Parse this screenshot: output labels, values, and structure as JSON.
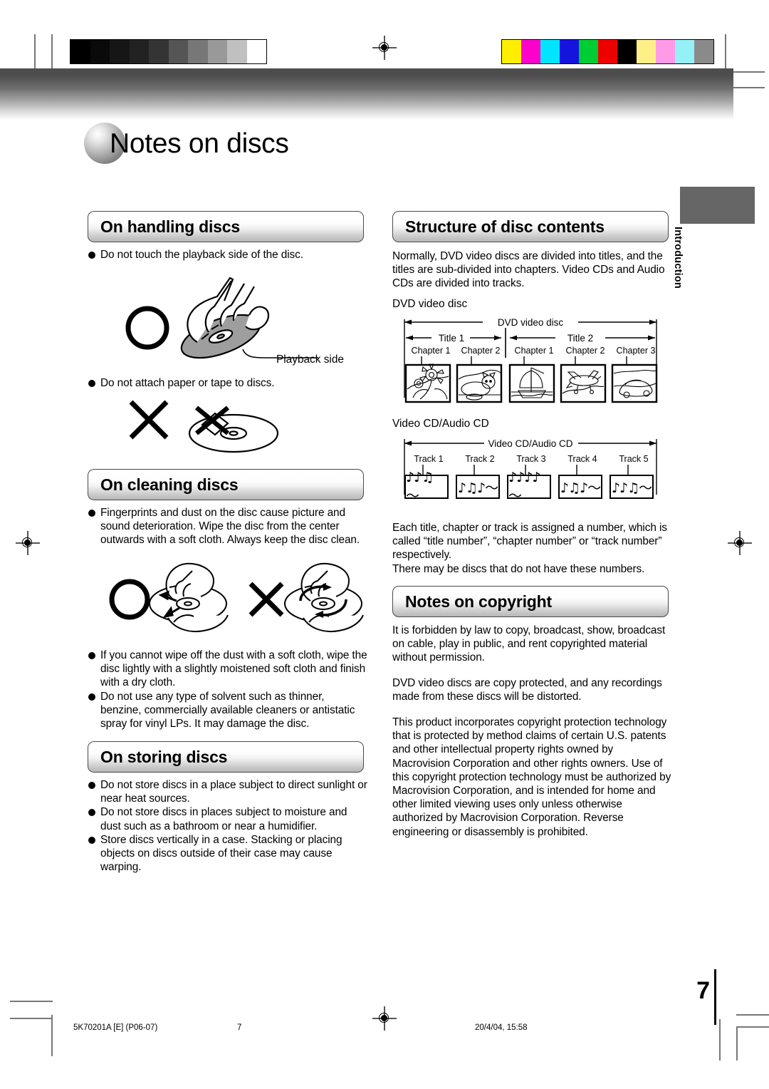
{
  "page": {
    "title": "Notes on discs",
    "number": "7",
    "side_tab": "Introduction"
  },
  "footer": {
    "doc_code": "5K70201A [E]  (P06-07)",
    "page_ref": "7",
    "timestamp": "20/4/04, 15:58"
  },
  "calibration": {
    "grayscale_steps": [
      "#000000",
      "#0a0a0a",
      "#161616",
      "#222222",
      "#343434",
      "#555555",
      "#777777",
      "#999999",
      "#c0c0c0",
      "#ffffff"
    ],
    "color_steps": [
      "#ffee00",
      "#ff00cc",
      "#00e5ff",
      "#1414dd",
      "#00cc33",
      "#ee0000",
      "#000000",
      "#ffef88",
      "#ff9ae8",
      "#96f0f7",
      "#8a8a8a"
    ]
  },
  "sections": {
    "handling": {
      "heading": "On handling discs",
      "bullets": [
        "Do not touch the playback side of the disc.",
        "Do not attach paper or tape to discs."
      ],
      "figure_caption": "Playback side"
    },
    "cleaning": {
      "heading": "On cleaning discs",
      "bullets": [
        "Fingerprints and dust on the disc cause picture and sound deterioration. Wipe the disc from the center outwards with a soft cloth. Always keep the disc clean.",
        "If you cannot wipe off the dust with a soft cloth, wipe the disc lightly with a slightly moistened soft cloth and finish with a dry cloth.",
        "Do not use any type of solvent such as thinner, benzine, commercially available cleaners or antistatic spray for vinyl LPs. It may damage the disc."
      ]
    },
    "storing": {
      "heading": "On storing discs",
      "bullets": [
        "Do not store discs in a place subject to direct sunlight or near heat sources.",
        "Do not store discs in places subject to moisture and dust such as a bathroom or near a humidifier.",
        "Store discs vertically in a case. Stacking or placing objects on discs outside of their case may cause warping."
      ]
    },
    "structure": {
      "heading": "Structure of disc contents",
      "intro": "Normally, DVD video discs are divided into titles, and the titles are sub-divided into chapters. Video CDs and Audio CDs are divided into tracks.",
      "dvd_label": "DVD video disc",
      "dvd_diagram": {
        "span_label": "DVD video disc",
        "titles": [
          {
            "label": "Title 1",
            "chapters": [
              "Chapter 1",
              "Chapter 2"
            ],
            "scenes": [
              "sunflower",
              "cat"
            ]
          },
          {
            "label": "Title 2",
            "chapters": [
              "Chapter 1",
              "Chapter 2",
              "Chapter 3"
            ],
            "scenes": [
              "sailing-ship",
              "airplane",
              "car"
            ]
          }
        ]
      },
      "cd_label": "Video CD/Audio CD",
      "cd_diagram": {
        "span_label": "Video CD/Audio CD",
        "tracks": [
          {
            "label": "Track 1",
            "notes": "♪♪♫  ～"
          },
          {
            "label": "Track 2",
            "notes": "♪♫♪～"
          },
          {
            "label": "Track 3",
            "notes": "♪♪♪♪～"
          },
          {
            "label": "Track 4",
            "notes": "♪♫♪～"
          },
          {
            "label": "Track 5",
            "notes": "♪♪♫～"
          }
        ]
      },
      "outro": "Each title, chapter or track is assigned a number, which is called “title number”, “chapter number” or “track number” respectively.\nThere may be discs that do not have these numbers."
    },
    "copyright": {
      "heading": "Notes on copyright",
      "paragraphs": [
        "It is forbidden by law to copy, broadcast, show, broadcast on cable, play in public, and rent copyrighted material without permission.",
        "DVD video discs are copy protected, and any recordings made from these discs will be distorted.",
        "This product incorporates copyright protection technology that is protected by method claims of certain U.S. patents and other intellectual property rights owned by Macrovision Corporation and other rights owners. Use of this copyright protection technology must be authorized by Macrovision Corporation, and is intended for home and other limited viewing uses only unless otherwise authorized by Macrovision Corporation. Reverse engineering or disassembly is prohibited."
      ]
    }
  }
}
